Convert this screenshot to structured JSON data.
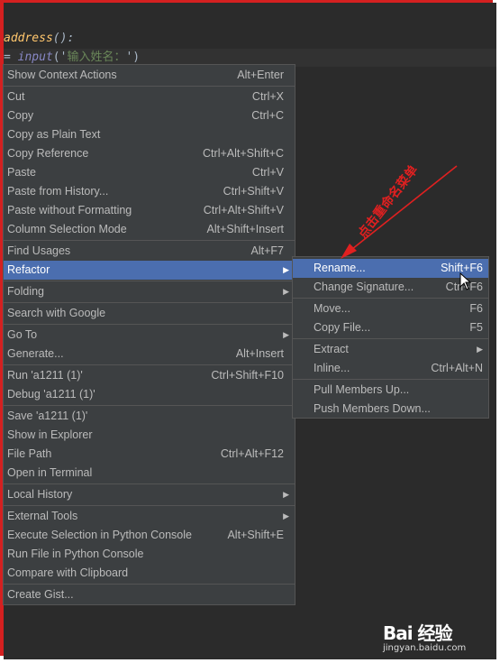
{
  "editor": {
    "line1": {
      "func": "address",
      "punc": "():"
    },
    "line2": {
      "op": "= ",
      "builtin": "input",
      "open": "('",
      "str": "输入姓名：",
      "close": "')"
    }
  },
  "context_menu": [
    {
      "label": "Show Context Actions",
      "shortcut": "Alt+Enter"
    },
    {
      "label": "Cut",
      "shortcut": "Ctrl+X"
    },
    {
      "label": "Copy",
      "shortcut": "Ctrl+C"
    },
    {
      "label": "Copy as Plain Text",
      "shortcut": ""
    },
    {
      "label": "Copy Reference",
      "shortcut": "Ctrl+Alt+Shift+C"
    },
    {
      "label": "Paste",
      "shortcut": "Ctrl+V"
    },
    {
      "label": "Paste from History...",
      "shortcut": "Ctrl+Shift+V"
    },
    {
      "label": "Paste without Formatting",
      "shortcut": "Ctrl+Alt+Shift+V"
    },
    {
      "label": "Column Selection Mode",
      "shortcut": "Alt+Shift+Insert"
    },
    {
      "label": "Find Usages",
      "shortcut": "Alt+F7"
    },
    {
      "label": "Refactor",
      "shortcut": ""
    },
    {
      "label": "Folding",
      "shortcut": ""
    },
    {
      "label": "Search with Google",
      "shortcut": ""
    },
    {
      "label": "Go To",
      "shortcut": ""
    },
    {
      "label": "Generate...",
      "shortcut": "Alt+Insert"
    },
    {
      "label": "Run 'a1211 (1)'",
      "shortcut": "Ctrl+Shift+F10"
    },
    {
      "label": "Debug 'a1211 (1)'",
      "shortcut": ""
    },
    {
      "label": "Save 'a1211 (1)'",
      "shortcut": ""
    },
    {
      "label": "Show in Explorer",
      "shortcut": ""
    },
    {
      "label": "File Path",
      "shortcut": "Ctrl+Alt+F12"
    },
    {
      "label": "Open in Terminal",
      "shortcut": ""
    },
    {
      "label": "Local History",
      "shortcut": ""
    },
    {
      "label": "External Tools",
      "shortcut": ""
    },
    {
      "label": "Execute Selection in Python Console",
      "shortcut": "Alt+Shift+E"
    },
    {
      "label": "Run File in Python Console",
      "shortcut": ""
    },
    {
      "label": "Compare with Clipboard",
      "shortcut": ""
    },
    {
      "label": "Create Gist...",
      "shortcut": ""
    }
  ],
  "refactor_submenu": [
    {
      "label": "Rename...",
      "shortcut": "Shift+F6"
    },
    {
      "label": "Change Signature...",
      "shortcut": "Ctrl+F6"
    },
    {
      "label": "Move...",
      "shortcut": "F6"
    },
    {
      "label": "Copy File...",
      "shortcut": "F5"
    },
    {
      "label": "Extract",
      "shortcut": ""
    },
    {
      "label": "Inline...",
      "shortcut": "Ctrl+Alt+N"
    },
    {
      "label": "Pull Members Up...",
      "shortcut": ""
    },
    {
      "label": "Push Members Down...",
      "shortcut": ""
    }
  ],
  "annotation": {
    "text": "点击重命名菜单",
    "color": "#e02020"
  },
  "watermark": {
    "logo": "Bai 经验",
    "sub": "jingyan.baidu.com"
  },
  "colors": {
    "highlight": "#4b6eaf",
    "menu_bg": "#3c3f41",
    "editor_bg": "#2b2b2b",
    "frame": "#d42020"
  },
  "icons": {
    "submenu_arrow": "triangle-right-icon",
    "pointer": "mouse-pointer-icon"
  }
}
